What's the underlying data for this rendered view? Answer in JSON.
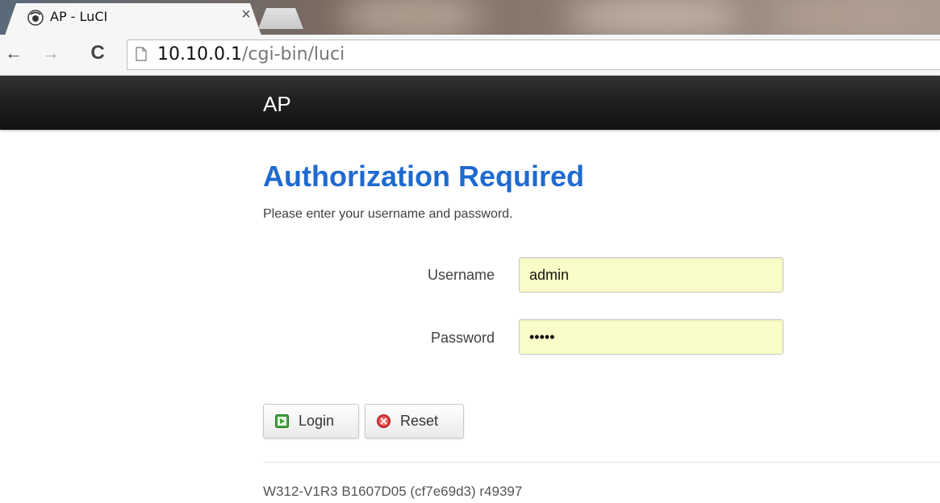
{
  "browser": {
    "tab": {
      "title": "AP - LuCI",
      "close_glyph": "×",
      "favicon": "luci-favicon-icon"
    },
    "nav": {
      "back_glyph": "←",
      "forward_glyph": "→",
      "reload_glyph": "C"
    },
    "url": {
      "host": "10.10.0.1",
      "path": "/cgi-bin/luci"
    }
  },
  "header": {
    "brand": "AP"
  },
  "auth": {
    "title": "Authorization Required",
    "description": "Please enter your username and password.",
    "fields": {
      "username": {
        "label": "Username",
        "value": "admin"
      },
      "password": {
        "label": "Password",
        "value": "admin"
      }
    },
    "buttons": {
      "login": {
        "label": "Login",
        "icon": "login-icon"
      },
      "reset": {
        "label": "Reset",
        "icon": "reset-icon"
      }
    }
  },
  "footer": {
    "version": "W312-V1R3 B1607D05 (cf7e69d3) r49397"
  },
  "colors": {
    "header_bg": "#222222",
    "title_blue": "#1f6ad0",
    "input_bg": "#fafdc8",
    "login_icon_green": "#3fa33a",
    "reset_icon_red": "#d9373a"
  }
}
